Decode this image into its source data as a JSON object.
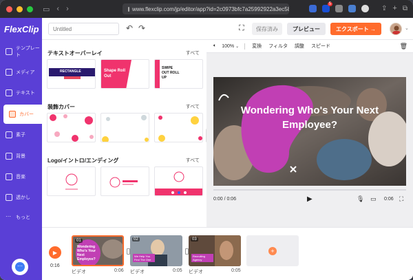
{
  "browser": {
    "url": "www.flexclip.com/jp/editor/app?id=2c0973bfc7a25992922a3ec58",
    "ext_badge": "5",
    "light_colors": [
      "#fe5f57",
      "#febc2e",
      "#28c840"
    ]
  },
  "app": {
    "logo": "FlexClip",
    "title_placeholder": "Untitled",
    "saved_label": "保存済み",
    "preview_label": "プレビュー",
    "export_label": "エクスポート →",
    "accent": "#ff6b2c",
    "brand": "#5a3fd6"
  },
  "sidebar": {
    "items": [
      {
        "label": "テンプレート",
        "icon": "template-icon"
      },
      {
        "label": "メディア",
        "icon": "media-icon"
      },
      {
        "label": "テキスト",
        "icon": "text-icon"
      },
      {
        "label": "カバー",
        "icon": "cover-icon",
        "active": true
      },
      {
        "label": "素子",
        "icon": "elements-icon"
      },
      {
        "label": "背景",
        "icon": "background-icon"
      },
      {
        "label": "音楽",
        "icon": "music-icon"
      },
      {
        "label": "透かし",
        "icon": "watermark-icon"
      },
      {
        "label": "もっと",
        "icon": "more-icon"
      }
    ]
  },
  "panel": {
    "sections": [
      {
        "title": "テキストオーバーレイ",
        "all": "すべて",
        "thumbs": [
          {
            "text": "RECTANGLE"
          },
          {
            "text": "Shape Roll Out"
          },
          {
            "text": "SWIPE OUT ROLL UP"
          }
        ]
      },
      {
        "title": "装飾カバー",
        "all": "すべて"
      },
      {
        "title": "Logo/イントロ/エンディング",
        "all": "すべて"
      }
    ]
  },
  "editor": {
    "volume_label": "100%",
    "toolbar": [
      "変換",
      "フィルタ",
      "調整",
      "スピード"
    ],
    "canvas_text": "Wondering Who's Your Next Employee?",
    "time_current": "0:00 / 0:06",
    "time_total": "0:06"
  },
  "timeline": {
    "total": "0:16",
    "clips": [
      {
        "num": "01",
        "label": "ビデオ",
        "duration": "0:06",
        "caption": "Wondering Who's Your Next Employee?"
      },
      {
        "num": "02",
        "label": "ビデオ",
        "duration": "0:05",
        "caption": "We Help You Find The One"
      },
      {
        "num": "03",
        "label": "ビデオ",
        "duration": "0:05",
        "caption": "Recruiting Agency"
      }
    ]
  }
}
